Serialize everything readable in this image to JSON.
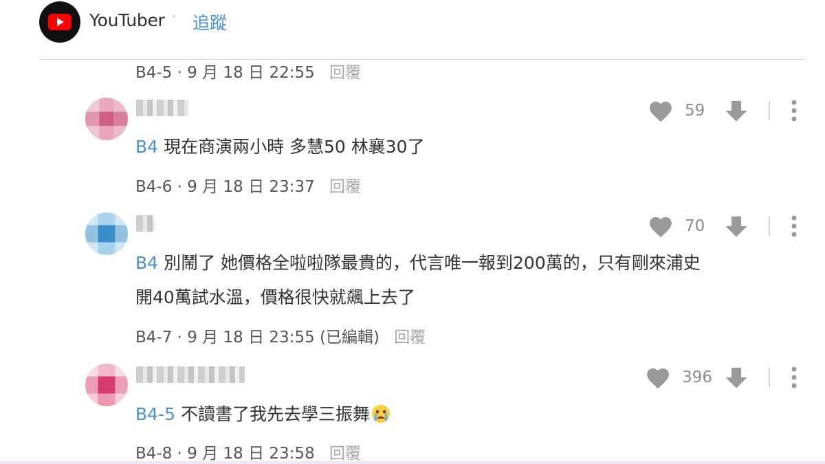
{
  "header": {
    "channel_name": "YouTuber",
    "separator": "·",
    "follow_label": "追蹤"
  },
  "top_meta": {
    "id": "B4-5",
    "date": "· 9 月 18 日 22:55",
    "reply_label": "回覆"
  },
  "comments": [
    {
      "likes": "59",
      "mention": "B4",
      "lines": [
        "現在商演兩小時 多慧50 林襄30了"
      ],
      "meta": "B4-6 · 9 月 18 日 23:37",
      "reply_label": "回覆"
    },
    {
      "likes": "70",
      "mention": "B4",
      "lines": [
        "別鬧了 她價格全啦啦隊最貴的，代言唯一報到200萬的，只有剛來浦史",
        "開40萬試水溫，價格很快就飆上去了"
      ],
      "meta": "B4-7 · 9 月 18 日 23:55 (已編輯)",
      "reply_label": "回覆"
    },
    {
      "likes": "396",
      "mention": "B4-5",
      "lines": [
        "不讀書了我先去學三振舞"
      ],
      "emoji_icon": "crying-face-icon",
      "meta": "B4-8 · 9 月 18 日 23:58",
      "reply_label": "回覆"
    }
  ],
  "icons": {
    "logo": "youtube-logo-icon",
    "like": "heart-icon",
    "dislike": "down-arrow-icon",
    "more": "more-vertical-icon"
  },
  "colors": {
    "accent": "#4a8fd0",
    "youtube_red": "#ff0000",
    "icon_gray": "#9a9a9a"
  }
}
